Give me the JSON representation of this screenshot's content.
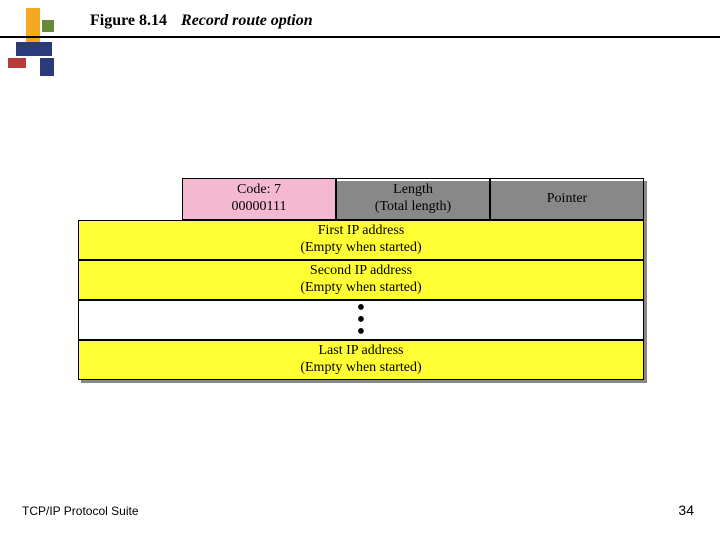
{
  "figure_label": "Figure 8.14",
  "figure_title": "Record route option",
  "header": {
    "code": {
      "line1": "Code: 7",
      "line2": "00000111"
    },
    "length": {
      "line1": "Length",
      "line2": "(Total length)"
    },
    "pointer": {
      "line1": "Pointer"
    }
  },
  "rows": {
    "first": {
      "line1": "First IP address",
      "line2": "(Empty when started)"
    },
    "second": {
      "line1": "Second IP address",
      "line2": "(Empty when started)"
    },
    "last": {
      "line1": "Last IP address",
      "line2": "(Empty when started)"
    }
  },
  "footer_left": "TCP/IP Protocol Suite",
  "page_number": "34",
  "logo_colors": {
    "orange": "#f7a823",
    "green": "#6a8a3a",
    "navy": "#2a3a7a",
    "red": "#b83a3a"
  }
}
